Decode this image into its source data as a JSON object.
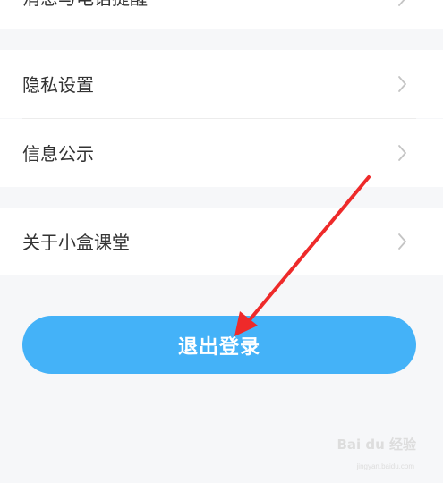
{
  "settings": {
    "items": [
      {
        "label": "消息与电话提醒"
      },
      {
        "label": "隐私设置"
      },
      {
        "label": "信息公示"
      },
      {
        "label": "关于小盒课堂"
      }
    ]
  },
  "logout": {
    "label": "退出登录"
  },
  "annotation": {
    "color": "#ee2a2a"
  },
  "watermark": {
    "brand": "Bai du 经验",
    "sub": "jingyan.baidu.com"
  },
  "colors": {
    "accent": "#44b2f8",
    "background": "#f6f7f9"
  }
}
